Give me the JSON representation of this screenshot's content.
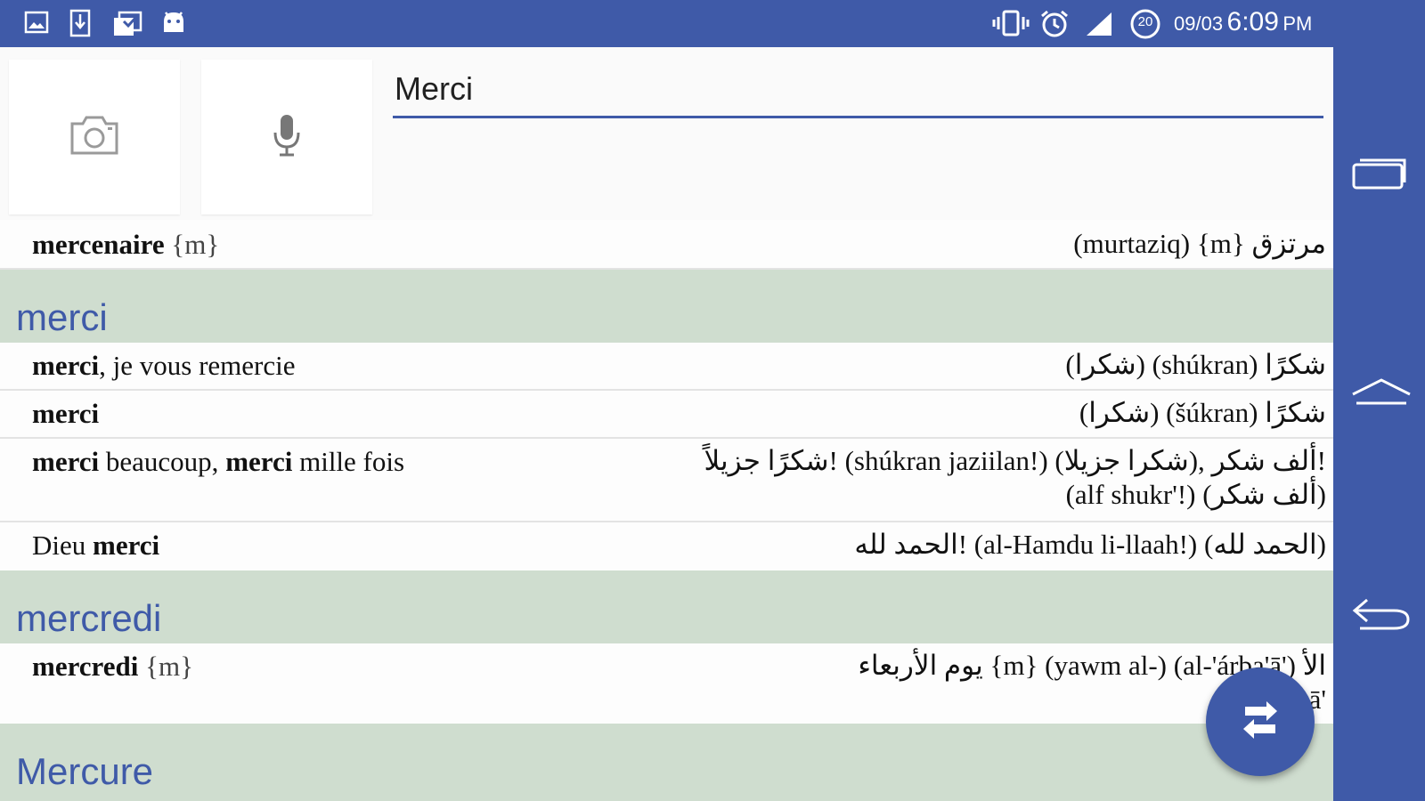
{
  "status_bar": {
    "date": "09/03",
    "time": "6:09",
    "ampm": "PM",
    "notification_badge": "20",
    "left_icons": [
      "image-icon",
      "download-icon",
      "clipboard-check-icon",
      "android-icon"
    ],
    "right_icons": [
      "vibrate-icon",
      "alarm-icon",
      "signal-icon",
      "notification-count-icon"
    ]
  },
  "search": {
    "value": "Merci",
    "camera_icon": "camera-icon",
    "mic_icon": "microphone-icon"
  },
  "entries": {
    "top_row": {
      "fr": "mercenaire",
      "fr_gender": "{m}",
      "ar": "(murtaziq) {m} مرتزق"
    },
    "merci_header": "merci",
    "merci_rows": [
      {
        "fr_bold": "merci",
        "fr_rest": ", je vous remercie",
        "ar": "(شكرا) (shúkran) شكرًا"
      },
      {
        "fr_bold": "merci",
        "fr_rest": "",
        "ar": "(شكرا) (šúkran) شكرًا"
      },
      {
        "fr_bold": "merci",
        "fr_mid": " beaucoup, ",
        "fr_bold2": "merci",
        "fr_rest": " mille fois",
        "ar_line1": "شكرًا جزيلاً! (shúkran jaziilan!) (شكرا جزيلا), ألف شكر!",
        "ar_line2": "(alf shukr'!) (ألف شكر)"
      },
      {
        "fr_pre": "Dieu ",
        "fr_bold": "merci",
        "ar": "الحمد لله! (al-Hamdu li-llaah!) (الحمد لله)"
      }
    ],
    "mercredi_header": "mercredi",
    "mercredi_row": {
      "fr": "mercredi",
      "fr_gender": "{m}",
      "ar_line1": "يوم الأربعاء {m} (yawm al-) (al-'árba'ā') الأ",
      "ar_line2": "ā'"
    },
    "mercure_header": "Mercure"
  },
  "navigation": {
    "recent_icon": "recent-apps-icon",
    "home_icon": "home-icon",
    "back_icon": "back-icon"
  },
  "fab_icon": "swap-languages-icon",
  "colors": {
    "primary": "#3f5aa8",
    "section_bg": "#cfddcf",
    "row_bg": "#fdfdfd"
  }
}
